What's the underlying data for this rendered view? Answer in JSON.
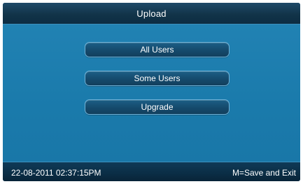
{
  "header": {
    "title": "Upload"
  },
  "menu": {
    "items": [
      {
        "label": "All Users"
      },
      {
        "label": "Some Users"
      },
      {
        "label": "Upgrade"
      }
    ]
  },
  "status_bar": {
    "datetime": "22-08-2011  02:37:15PM",
    "hint": "M=Save and Exit"
  },
  "colors": {
    "background": "#1b78a8",
    "title_bar": "#123449",
    "button": "#154a6c",
    "button_border": "#6fb2d8",
    "text": "#ffffff"
  }
}
